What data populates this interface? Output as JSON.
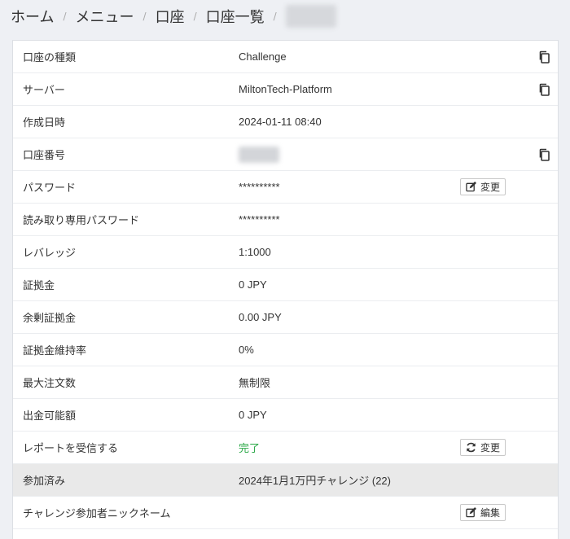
{
  "breadcrumb": {
    "items": [
      "ホーム",
      "メニュー",
      "口座",
      "口座一覧"
    ],
    "separator": "/"
  },
  "account": {
    "rows": [
      {
        "label": "口座の種類",
        "value": "Challenge",
        "copy": true
      },
      {
        "label": "サーバー",
        "value": "MiltonTech-Platform",
        "copy": true
      },
      {
        "label": "作成日時",
        "value": "2024-01-11 08:40"
      },
      {
        "label": "口座番号",
        "value": "",
        "redacted": true,
        "copy": true
      },
      {
        "label": "パスワード",
        "value": "**********",
        "action": "変更",
        "action_icon": "edit-icon"
      },
      {
        "label": "読み取り専用パスワード",
        "value": "**********"
      },
      {
        "label": "レバレッジ",
        "value": "1:1000"
      },
      {
        "label": "証拠金",
        "value": "0 JPY"
      },
      {
        "label": "余剰証拠金",
        "value": "0.00 JPY"
      },
      {
        "label": "証拠金維持率",
        "value": "0%"
      },
      {
        "label": "最大注文数",
        "value": "無制限"
      },
      {
        "label": "出金可能額",
        "value": "0 JPY"
      },
      {
        "label": "レポートを受信する",
        "value": "完了",
        "status": "success",
        "action": "変更",
        "action_icon": "refresh-icon"
      },
      {
        "label": "参加済み",
        "value": "2024年1月1万円チャレンジ (22)",
        "highlight": true
      },
      {
        "label": "チャレンジ参加者ニックネーム",
        "value": "",
        "action": "編集",
        "action_icon": "edit-icon"
      }
    ]
  },
  "colors": {
    "background": "#eef0f4",
    "success": "#28a745",
    "highlight_row": "#e9e9e9"
  }
}
